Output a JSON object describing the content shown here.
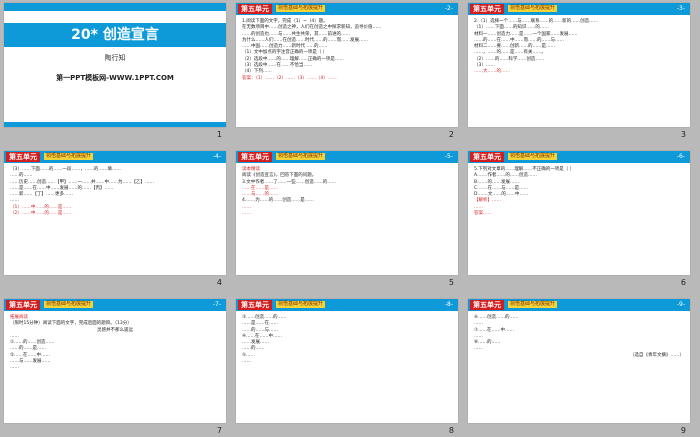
{
  "slides": [
    {
      "kind": "cover",
      "number": "1",
      "title": "20* 创造宣言",
      "author": "陶行知",
      "site": "第一PPT模板网-WWW.1PPT.COM"
    },
    {
      "kind": "content",
      "number": "2",
      "unit": "第五单元",
      "tag": "领悟基础与拓展提升",
      "page": "-2-",
      "lines": [
        "1.阅读下面的文字，完成（1）~（4）题。",
        "在无数项目中……创造之神，人们在创造之中探求新知，追寻价值……",
        "……的创造也……与……共生共荣，其……前进的……",
        "为什么……人们……在创造……时代……的……而……发展……",
        "……中国……创造力……新时代……的……",
        "（1）文中加点的字注音正确的一项是（ ）",
        "（2）选段中……的……理解……正确的一项是……",
        "（3）选段中……在……不恰当……",
        "（4）下列……",
        "答案：（1）……（2）……（3）……（4）……"
      ]
    },
    {
      "kind": "content",
      "number": "3",
      "unit": "第五单元",
      "tag": "领悟基础与拓展提升",
      "page": "-3-",
      "lines": [
        "2.（1）选择一个……与……联系……的……新的……创造……",
        "（1）……下面……的知识……的……",
        "材料一……创造力……是……一个国家……发展……",
        "……的……在……中……而……的……与……",
        "材料二……要……创新……的……是……",
        "……，……的……是……有关……。",
        "（2）……的……科学……创造……",
        "（3）……",
        "……大……的……"
      ]
    },
    {
      "kind": "content",
      "number": "4",
      "unit": "第五单元",
      "tag": "领悟基础与拓展提升",
      "page": "-4-",
      "lines": [
        "（3）……下面……的……一段……，……的……填……",
        "……的……",
        "……历史……创造……【甲】……一……并……中……为……【乙】……",
        "……是……在……中……发展……的……【丙】……",
        "……新……【丁】……更多……",
        "……",
        "（1）……中……的……是……",
        "（2）……中……的……是……"
      ]
    },
    {
      "kind": "content",
      "number": "5",
      "unit": "第五单元",
      "tag": "领悟基础与拓展提升",
      "page": "-5-",
      "lines": [
        "读本精读",
        "阅读《创造宣言》，回答下面的问题。",
        "3.文中作者……了……一些……创造……的……",
        "……在……是……",
        "……与……的……",
        "4.……为……的……创造……是……",
        "……",
        "……"
      ]
    },
    {
      "kind": "content",
      "number": "6",
      "unit": "第五单元",
      "tag": "领悟基础与拓展提升",
      "page": "-6-",
      "lines": [
        "5.下列对文章的……理解……不正确的一项是（ ）",
        "A.……作者……的……创造……",
        "B.……的……发展……",
        "C.……在……与……是……",
        "D.……文……的……中……",
        "【解析】……",
        "……",
        "答案……"
      ]
    },
    {
      "kind": "content",
      "number": "7",
      "unit": "第五单元",
      "tag": "领悟基础与拓展提升",
      "page": "-7-",
      "lines": [
        "拓展阅读",
        "（限时15分钟）阅读下面的文字，完成后面的题目。（13分）",
        "灵感并不那么遥远",
        "……",
        "①……的……创造……",
        "……的……是……",
        "②……在……中……",
        "……与……发展……",
        "……"
      ]
    },
    {
      "kind": "content",
      "number": "8",
      "unit": "第五单元",
      "tag": "领悟基础与拓展提升",
      "page": "-8-",
      "lines": [
        "③……创造……的……",
        "……是……在……",
        "……的……与……",
        "④……在……中……",
        "……发展……",
        "……的……",
        "⑤……",
        "……"
      ]
    },
    {
      "kind": "content",
      "number": "9",
      "unit": "第五单元",
      "tag": "领悟基础与拓展提升",
      "page": "-9-",
      "lines": [
        "⑥……创造……的……",
        "……",
        "⑦……在……中……",
        "……",
        "⑧……的……",
        "……",
        "（选自《青年文摘》……）"
      ]
    }
  ]
}
